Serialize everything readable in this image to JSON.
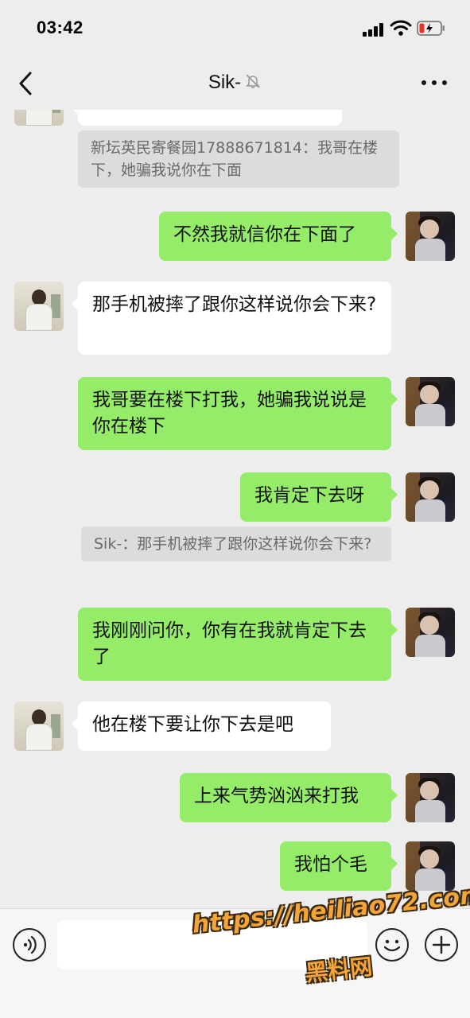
{
  "status_bar": {
    "time": "03:42"
  },
  "header": {
    "title": "Sik-",
    "back_icon": "chevron-left-icon",
    "mute_icon": "bell-slash-icon",
    "more_icon": "more-dots-icon"
  },
  "messages": [
    {
      "side": "in",
      "kind": "cutoff",
      "text": ""
    },
    {
      "side": "quote",
      "text": "新坛英民寄餐园17888671814：我哥在楼下，她骗我说你在下面"
    },
    {
      "side": "out",
      "text": "不然我就信你在下面了"
    },
    {
      "side": "in",
      "text": "那手机被摔了跟你这样说你会下来?"
    },
    {
      "side": "out",
      "text": "我哥要在楼下打我，她骗我说说是你在楼下"
    },
    {
      "side": "out",
      "text": "我肯定下去呀"
    },
    {
      "side": "quote",
      "text": "Sik-：那手机被摔了跟你这样说你会下来?"
    },
    {
      "side": "out",
      "text": "我刚刚问你，你有在我就肯定下去了"
    },
    {
      "side": "in",
      "text": "他在楼下要让你下去是吧"
    },
    {
      "side": "out",
      "text": "上来气势汹汹来打我"
    },
    {
      "side": "out",
      "text": "我怕个毛"
    }
  ],
  "input_bar": {
    "voice_icon": "voice-icon",
    "emoji_icon": "emoji-icon",
    "plus_icon": "plus-icon",
    "input_value": ""
  },
  "watermark": {
    "url": "https://heiliao72.com",
    "name": "黑料网"
  },
  "colors": {
    "background": "#ededed",
    "outgoing_bubble": "#95ec69",
    "incoming_bubble": "#ffffff",
    "quote_bubble": "#dcdcdc"
  }
}
